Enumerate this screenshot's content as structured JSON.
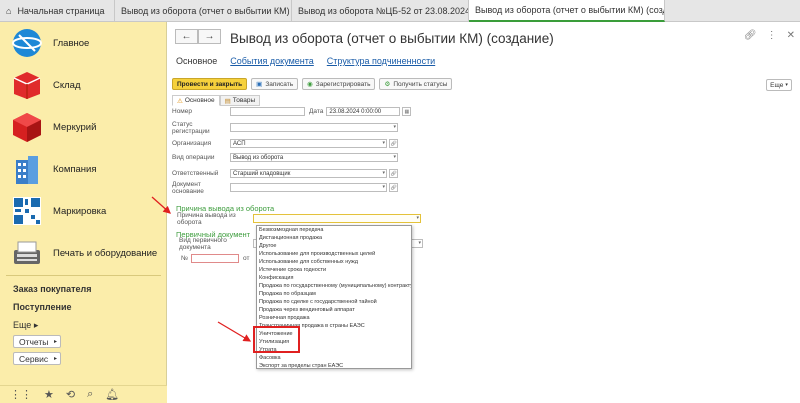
{
  "tabs": [
    {
      "label": "Начальная страница"
    },
    {
      "label": "Вывод из оборота (отчет о выбытии КМ)"
    },
    {
      "label": "Вывод из оборота №ЦБ-52 от 23.08.2024"
    },
    {
      "label": "Вывод из оборота (отчет о выбытии КМ) (создание)"
    }
  ],
  "sidebar": {
    "items": [
      {
        "label": "Главное"
      },
      {
        "label": "Склад"
      },
      {
        "label": "Меркурий"
      },
      {
        "label": "Компания"
      },
      {
        "label": "Маркировка"
      },
      {
        "label": "Печать и оборудование"
      }
    ],
    "links": [
      "Заказ покупателя",
      "Поступление"
    ],
    "more": "Еще",
    "reports": "Отчеты",
    "service": "Сервис"
  },
  "window": {
    "title": "Вывод из оборота (отчет о выбытии КМ) (создание)",
    "doc_links": [
      "Основное",
      "События документа",
      "Структура подчиненности"
    ]
  },
  "toolbar": {
    "post_close": "Провести и закрыть",
    "save": "Записать",
    "register": "Зарегистрировать",
    "get_statuses": "Получить статусы",
    "more": "Еще"
  },
  "inner_tabs": [
    "Основное",
    "Товары"
  ],
  "form": {
    "number_label": "Номер",
    "date_label": "Дата",
    "date_value": "23.08.2024  0:00:00",
    "status_label": "Статус регистрации",
    "org_label": "Организация",
    "org_value": "АСП",
    "op_label": "Вид операции",
    "op_value": "Вывод из оборота",
    "resp_label": "Ответственный",
    "resp_value": "Старший кладовщик",
    "base_label": "Документ основание",
    "group_reason": "Причина вывода из оборота",
    "reason_label": "Причина вывода из оборота",
    "group_primary": "Первичный документ",
    "primary_kind_label": "Вид первичного документа",
    "num_label": "№",
    "from_label": "от"
  },
  "dropdown_options": [
    "Безвозмездная передача",
    "Дистанционная продажа",
    "Другое",
    "Использование для производственных целей",
    "Использование для собственных нужд",
    "Истечение срока годности",
    "Конфискация",
    "Продажа по государственному (муниципальному) контракту",
    "Продажа по образцам",
    "Продажа по сделке с государственной тайной",
    "Продажа через  вендинговый аппарат",
    "Розничная продажа",
    "Трансграничная продажа в страны ЕАЭС",
    "Уничтожение",
    "Утилизация",
    "Утрата",
    "Фасовка",
    "Экспорт за пределы стран ЕАЭС"
  ],
  "colors": {
    "accent_green": "#3d9d3d",
    "sidebar_bg": "#fbedaa",
    "primary_btn": "#f6d13c",
    "annotation_red": "#e02020"
  }
}
